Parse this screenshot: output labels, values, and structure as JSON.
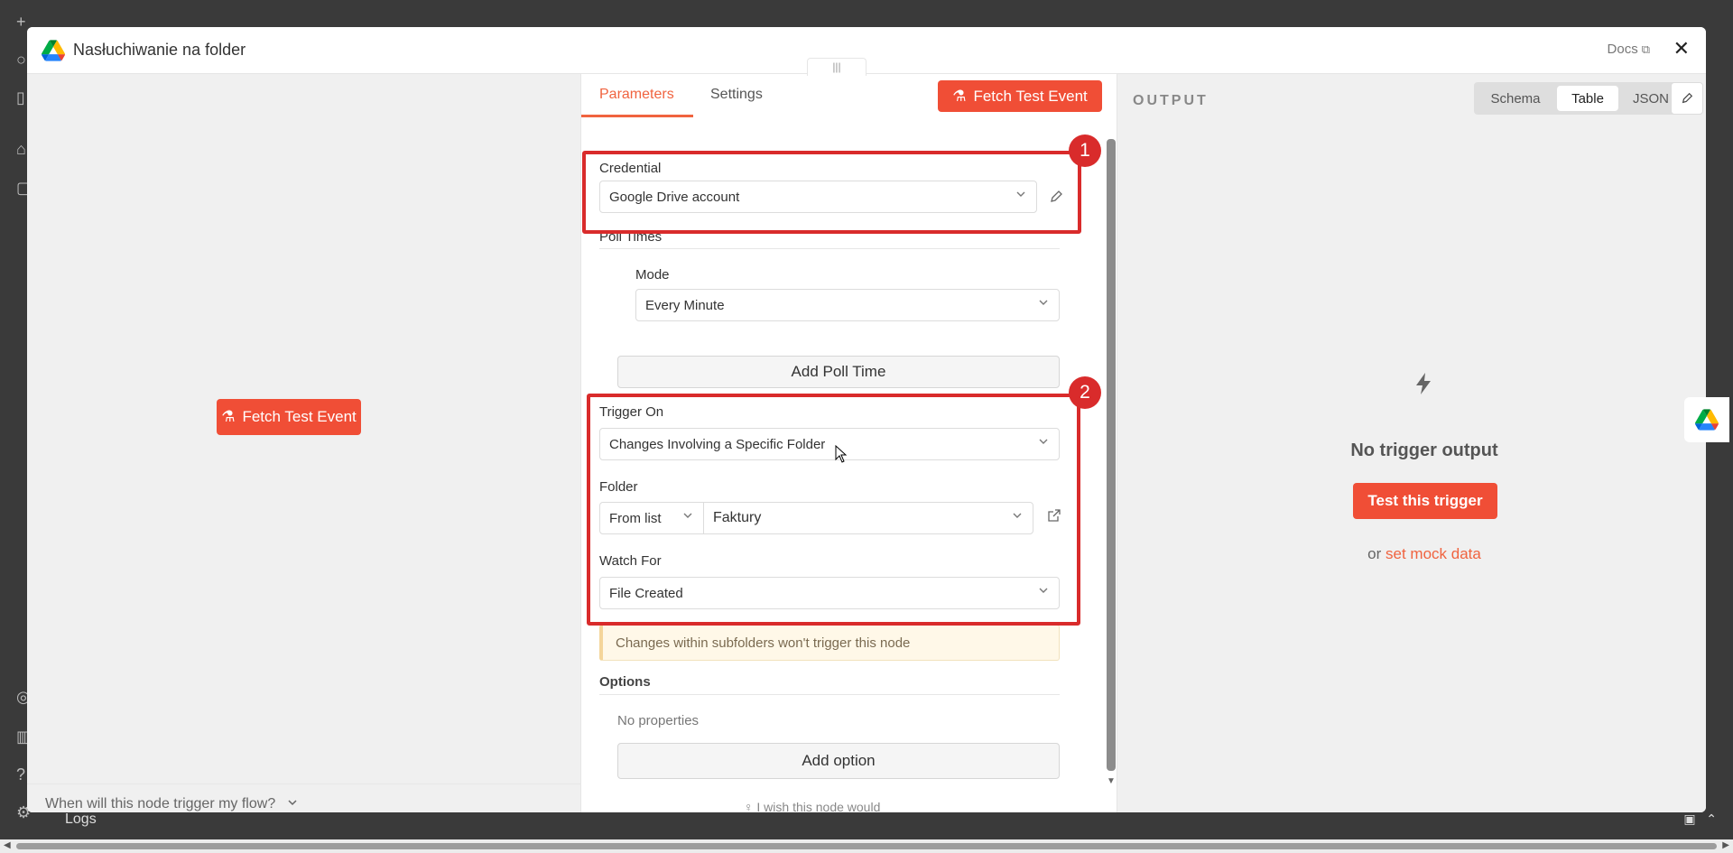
{
  "background": {
    "logs_label": "Logs"
  },
  "header": {
    "title": "Nasłuchiwanie na folder",
    "docs_label": "Docs",
    "close_glyph": "✕"
  },
  "left_pane": {
    "fetch_button": "Fetch Test Event",
    "trigger_question": "When will this node trigger my flow?"
  },
  "mid_pane": {
    "drag_handle": "|||",
    "tabs": [
      {
        "label": "Parameters",
        "active": true
      },
      {
        "label": "Settings",
        "active": false
      }
    ],
    "fetch_button": "Fetch Test Event",
    "credential": {
      "label": "Credential",
      "value": "Google Drive account"
    },
    "poll_times": {
      "label": "Poll Times"
    },
    "mode": {
      "label": "Mode",
      "value": "Every Minute"
    },
    "add_poll_time": "Add Poll Time",
    "trigger_on": {
      "label": "Trigger On",
      "value": "Changes Involving a Specific Folder"
    },
    "folder": {
      "label": "Folder",
      "source": "From list",
      "value": "Faktury"
    },
    "watch_for": {
      "label": "Watch For",
      "value": "File Created"
    },
    "notice": "Changes within subfolders won't trigger this node",
    "options": {
      "label": "Options",
      "empty": "No properties"
    },
    "add_option": "Add option",
    "wish_text": "I wish this node would",
    "annotations": [
      "1",
      "2"
    ]
  },
  "right_pane": {
    "output_label": "OUTPUT",
    "views": [
      {
        "label": "Schema",
        "active": false
      },
      {
        "label": "Table",
        "active": true
      },
      {
        "label": "JSON",
        "active": false
      }
    ],
    "no_output": "No trigger output",
    "test_button": "Test this trigger",
    "mock_prefix": "or",
    "mock_link": "set mock data"
  },
  "colors": {
    "accent": "#f04e36",
    "annotation": "#d92b2b"
  }
}
